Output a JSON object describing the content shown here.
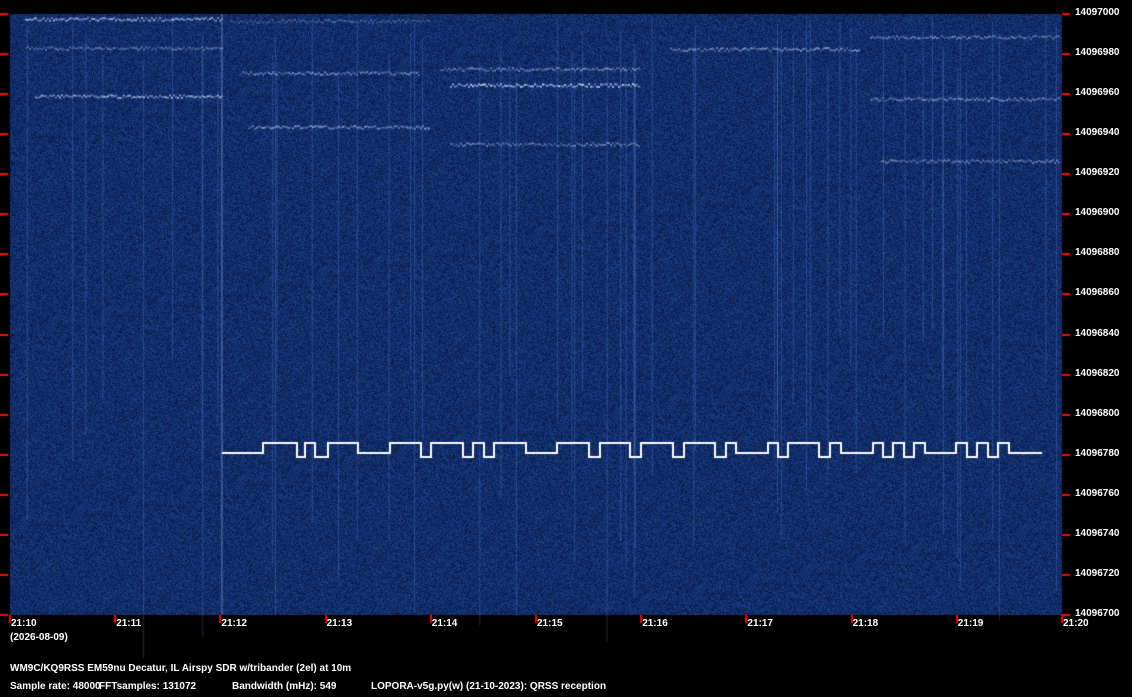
{
  "colors": {
    "background": "#000000",
    "waterfall_base": "#0b1f5c",
    "tick": "#ff0000",
    "signal": "#ffffff",
    "text": "#ffffff"
  },
  "frequency_axis": {
    "unit": "Hz",
    "labels": [
      "14097000",
      "14096980",
      "14096960",
      "14096940",
      "14096920",
      "14096900",
      "14096880",
      "14096860",
      "14096840",
      "14096820",
      "14096800",
      "14096780",
      "14096760",
      "14096740",
      "14096720",
      "14096700"
    ]
  },
  "time_axis": {
    "labels": [
      "21:10",
      "21:11",
      "21:12",
      "21:13",
      "21:14",
      "21:15",
      "21:16",
      "21:17",
      "21:18",
      "21:19",
      "21:20"
    ],
    "date": "(2026-08-09)"
  },
  "signal": {
    "start_time": "21:12",
    "base_freq_hz": 14096781,
    "high_freq_hz": 14096786,
    "low_freq_hz": 14096779,
    "mode": "QRSS frequency-shift keying"
  },
  "footer": {
    "station": "WM9C/KQ9RSS EM59nu Decatur, IL  Airspy SDR w/tribander (2el) at 10m",
    "sample_rate": "Sample rate: 48000",
    "fft_samples": "FFTsamples: 131072",
    "bandwidth": "Bandwidth (mHz): 549",
    "software": "LOPORA-v5g.py(w) (21-10-2023): QRSS reception"
  }
}
